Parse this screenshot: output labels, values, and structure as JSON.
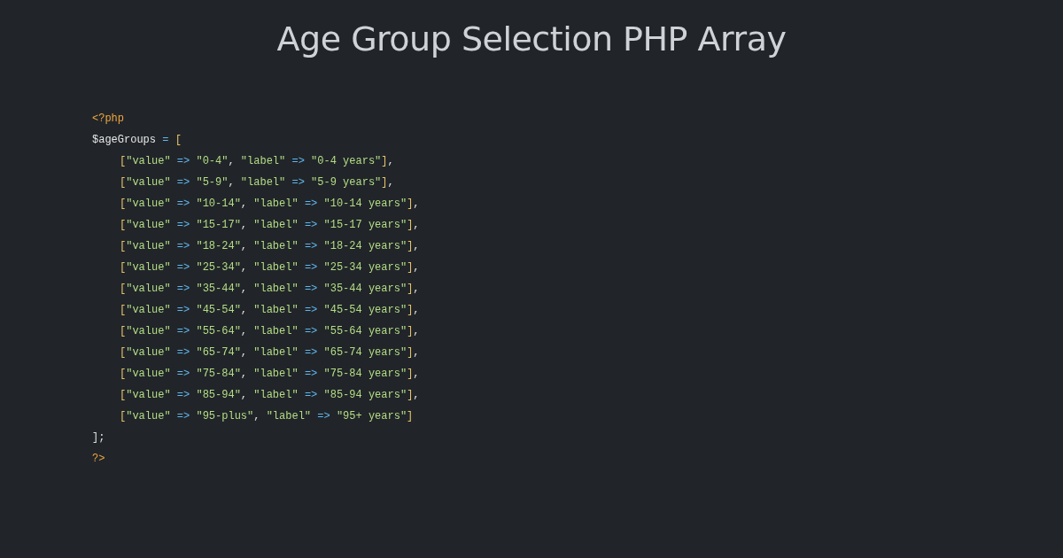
{
  "title": "Age Group Selection PHP Array",
  "code": [
    {
      "tokens": [
        {
          "kind": "tag",
          "text": "<?php"
        }
      ]
    },
    {
      "tokens": [
        {
          "kind": "var",
          "text": "$ageGroups"
        },
        {
          "kind": "op",
          "text": " = "
        },
        {
          "kind": "bracket",
          "text": "["
        }
      ],
      "children": [
        {
          "tokens": [
            {
              "kind": "bracket",
              "text": "["
            },
            {
              "kind": "str",
              "text": "\"value\""
            },
            {
              "kind": "op",
              "text": " => "
            },
            {
              "kind": "str",
              "text": "\"0-4\""
            },
            {
              "kind": "plain",
              "text": ", "
            },
            {
              "kind": "str",
              "text": "\"label\""
            },
            {
              "kind": "op",
              "text": " => "
            },
            {
              "kind": "str",
              "text": "\"0-4 years\""
            },
            {
              "kind": "bracket",
              "text": "]"
            },
            {
              "kind": "plain",
              "text": ","
            }
          ]
        },
        {
          "tokens": [
            {
              "kind": "bracket",
              "text": "["
            },
            {
              "kind": "str",
              "text": "\"value\""
            },
            {
              "kind": "op",
              "text": " => "
            },
            {
              "kind": "str",
              "text": "\"5-9\""
            },
            {
              "kind": "plain",
              "text": ", "
            },
            {
              "kind": "str",
              "text": "\"label\""
            },
            {
              "kind": "op",
              "text": " => "
            },
            {
              "kind": "str",
              "text": "\"5-9 years\""
            },
            {
              "kind": "bracket",
              "text": "]"
            },
            {
              "kind": "plain",
              "text": ","
            }
          ]
        },
        {
          "tokens": [
            {
              "kind": "bracket",
              "text": "["
            },
            {
              "kind": "str",
              "text": "\"value\""
            },
            {
              "kind": "op",
              "text": " => "
            },
            {
              "kind": "str",
              "text": "\"10-14\""
            },
            {
              "kind": "plain",
              "text": ", "
            },
            {
              "kind": "str",
              "text": "\"label\""
            },
            {
              "kind": "op",
              "text": " => "
            },
            {
              "kind": "str",
              "text": "\"10-14 years\""
            },
            {
              "kind": "bracket",
              "text": "]"
            },
            {
              "kind": "plain",
              "text": ","
            }
          ]
        },
        {
          "tokens": [
            {
              "kind": "bracket",
              "text": "["
            },
            {
              "kind": "str",
              "text": "\"value\""
            },
            {
              "kind": "op",
              "text": " => "
            },
            {
              "kind": "str",
              "text": "\"15-17\""
            },
            {
              "kind": "plain",
              "text": ", "
            },
            {
              "kind": "str",
              "text": "\"label\""
            },
            {
              "kind": "op",
              "text": " => "
            },
            {
              "kind": "str",
              "text": "\"15-17 years\""
            },
            {
              "kind": "bracket",
              "text": "]"
            },
            {
              "kind": "plain",
              "text": ","
            }
          ]
        },
        {
          "tokens": [
            {
              "kind": "bracket",
              "text": "["
            },
            {
              "kind": "str",
              "text": "\"value\""
            },
            {
              "kind": "op",
              "text": " => "
            },
            {
              "kind": "str",
              "text": "\"18-24\""
            },
            {
              "kind": "plain",
              "text": ", "
            },
            {
              "kind": "str",
              "text": "\"label\""
            },
            {
              "kind": "op",
              "text": " => "
            },
            {
              "kind": "str",
              "text": "\"18-24 years\""
            },
            {
              "kind": "bracket",
              "text": "]"
            },
            {
              "kind": "plain",
              "text": ","
            }
          ]
        },
        {
          "tokens": [
            {
              "kind": "bracket",
              "text": "["
            },
            {
              "kind": "str",
              "text": "\"value\""
            },
            {
              "kind": "op",
              "text": " => "
            },
            {
              "kind": "str",
              "text": "\"25-34\""
            },
            {
              "kind": "plain",
              "text": ", "
            },
            {
              "kind": "str",
              "text": "\"label\""
            },
            {
              "kind": "op",
              "text": " => "
            },
            {
              "kind": "str",
              "text": "\"25-34 years\""
            },
            {
              "kind": "bracket",
              "text": "]"
            },
            {
              "kind": "plain",
              "text": ","
            }
          ]
        },
        {
          "tokens": [
            {
              "kind": "bracket",
              "text": "["
            },
            {
              "kind": "str",
              "text": "\"value\""
            },
            {
              "kind": "op",
              "text": " => "
            },
            {
              "kind": "str",
              "text": "\"35-44\""
            },
            {
              "kind": "plain",
              "text": ", "
            },
            {
              "kind": "str",
              "text": "\"label\""
            },
            {
              "kind": "op",
              "text": " => "
            },
            {
              "kind": "str",
              "text": "\"35-44 years\""
            },
            {
              "kind": "bracket",
              "text": "]"
            },
            {
              "kind": "plain",
              "text": ","
            }
          ]
        },
        {
          "tokens": [
            {
              "kind": "bracket",
              "text": "["
            },
            {
              "kind": "str",
              "text": "\"value\""
            },
            {
              "kind": "op",
              "text": " => "
            },
            {
              "kind": "str",
              "text": "\"45-54\""
            },
            {
              "kind": "plain",
              "text": ", "
            },
            {
              "kind": "str",
              "text": "\"label\""
            },
            {
              "kind": "op",
              "text": " => "
            },
            {
              "kind": "str",
              "text": "\"45-54 years\""
            },
            {
              "kind": "bracket",
              "text": "]"
            },
            {
              "kind": "plain",
              "text": ","
            }
          ]
        },
        {
          "tokens": [
            {
              "kind": "bracket",
              "text": "["
            },
            {
              "kind": "str",
              "text": "\"value\""
            },
            {
              "kind": "op",
              "text": " => "
            },
            {
              "kind": "str",
              "text": "\"55-64\""
            },
            {
              "kind": "plain",
              "text": ", "
            },
            {
              "kind": "str",
              "text": "\"label\""
            },
            {
              "kind": "op",
              "text": " => "
            },
            {
              "kind": "str",
              "text": "\"55-64 years\""
            },
            {
              "kind": "bracket",
              "text": "]"
            },
            {
              "kind": "plain",
              "text": ","
            }
          ]
        },
        {
          "tokens": [
            {
              "kind": "bracket",
              "text": "["
            },
            {
              "kind": "str",
              "text": "\"value\""
            },
            {
              "kind": "op",
              "text": " => "
            },
            {
              "kind": "str",
              "text": "\"65-74\""
            },
            {
              "kind": "plain",
              "text": ", "
            },
            {
              "kind": "str",
              "text": "\"label\""
            },
            {
              "kind": "op",
              "text": " => "
            },
            {
              "kind": "str",
              "text": "\"65-74 years\""
            },
            {
              "kind": "bracket",
              "text": "]"
            },
            {
              "kind": "plain",
              "text": ","
            }
          ]
        },
        {
          "tokens": [
            {
              "kind": "bracket",
              "text": "["
            },
            {
              "kind": "str",
              "text": "\"value\""
            },
            {
              "kind": "op",
              "text": " => "
            },
            {
              "kind": "str",
              "text": "\"75-84\""
            },
            {
              "kind": "plain",
              "text": ", "
            },
            {
              "kind": "str",
              "text": "\"label\""
            },
            {
              "kind": "op",
              "text": " => "
            },
            {
              "kind": "str",
              "text": "\"75-84 years\""
            },
            {
              "kind": "bracket",
              "text": "]"
            },
            {
              "kind": "plain",
              "text": ","
            }
          ]
        },
        {
          "tokens": [
            {
              "kind": "bracket",
              "text": "["
            },
            {
              "kind": "str",
              "text": "\"value\""
            },
            {
              "kind": "op",
              "text": " => "
            },
            {
              "kind": "str",
              "text": "\"85-94\""
            },
            {
              "kind": "plain",
              "text": ", "
            },
            {
              "kind": "str",
              "text": "\"label\""
            },
            {
              "kind": "op",
              "text": " => "
            },
            {
              "kind": "str",
              "text": "\"85-94 years\""
            },
            {
              "kind": "bracket",
              "text": "]"
            },
            {
              "kind": "plain",
              "text": ","
            }
          ]
        },
        {
          "tokens": [
            {
              "kind": "bracket",
              "text": "["
            },
            {
              "kind": "str",
              "text": "\"value\""
            },
            {
              "kind": "op",
              "text": " => "
            },
            {
              "kind": "str",
              "text": "\"95-plus\""
            },
            {
              "kind": "plain",
              "text": ", "
            },
            {
              "kind": "str",
              "text": "\"label\""
            },
            {
              "kind": "op",
              "text": " => "
            },
            {
              "kind": "str",
              "text": "\"95+ years\""
            },
            {
              "kind": "bracket",
              "text": "]"
            }
          ]
        }
      ]
    },
    {
      "tokens": [
        {
          "kind": "plain",
          "text": "];"
        }
      ]
    },
    {
      "tokens": [
        {
          "kind": "tag",
          "text": "?>"
        }
      ]
    }
  ]
}
